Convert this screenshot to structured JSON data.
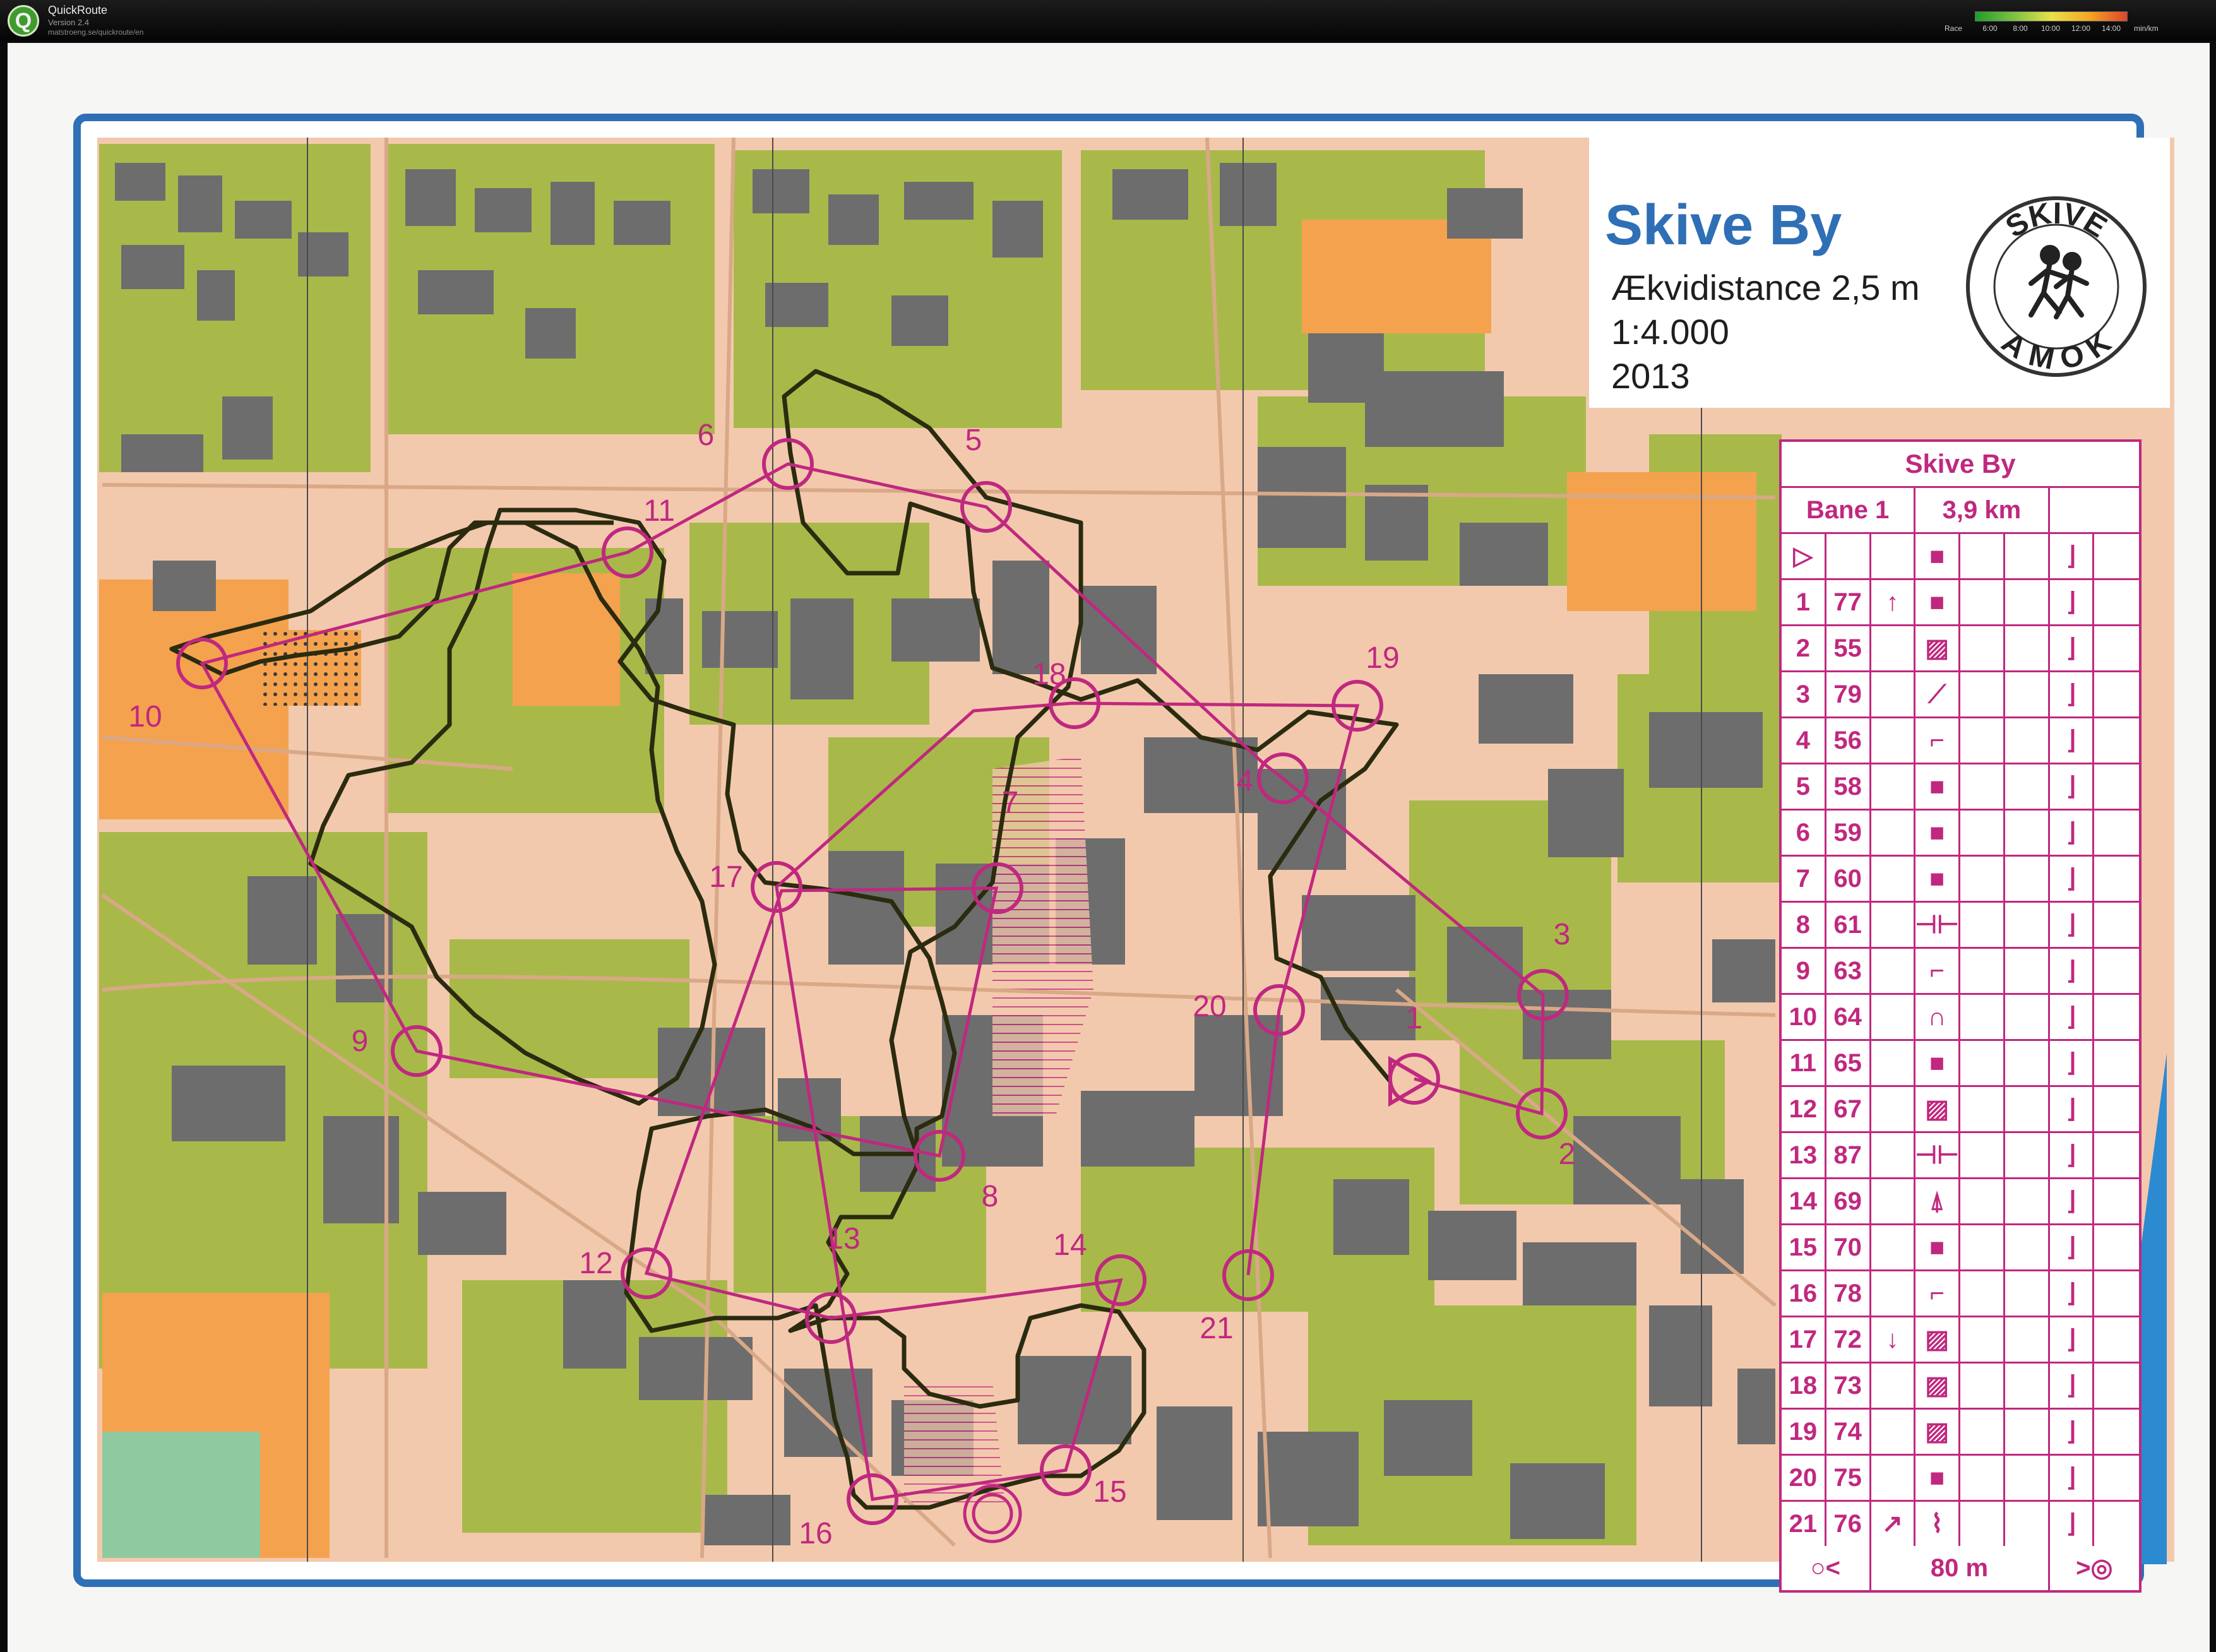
{
  "app": {
    "name": "QuickRoute",
    "version": "Version 2.4",
    "url": "matstroeng.se/quickroute/en",
    "legend_label": "Race",
    "legend_unit": "min/km",
    "legend_ticks": [
      "6:00",
      "8:00",
      "10:00",
      "12:00",
      "14:00"
    ]
  },
  "map": {
    "title": "Skive By",
    "equidistance": "Ækvidistance 2,5 m",
    "scale": "1:4.000",
    "year": "2013",
    "club_logo_top": "SKIVE",
    "club_logo_bottom": "AMOK",
    "colors": {
      "frame": "#2e6fb5",
      "paved": "#f3c9ad",
      "park": "#a8b94a",
      "building": "#6d6d6d",
      "open": "#f5a24e",
      "course": "#c0287f",
      "route": "#2b2b0f",
      "water": "#2c8ad0"
    }
  },
  "controls": [
    {
      "label": "1"
    },
    {
      "label": "2"
    },
    {
      "label": "3"
    },
    {
      "label": "4"
    },
    {
      "label": "5"
    },
    {
      "label": "6"
    },
    {
      "label": "7"
    },
    {
      "label": "8"
    },
    {
      "label": "9"
    },
    {
      "label": "10"
    },
    {
      "label": "11"
    },
    {
      "label": "12"
    },
    {
      "label": "13"
    },
    {
      "label": "14"
    },
    {
      "label": "15"
    },
    {
      "label": "16"
    },
    {
      "label": "17"
    },
    {
      "label": "18"
    },
    {
      "label": "19"
    },
    {
      "label": "20"
    },
    {
      "label": "21"
    }
  ],
  "description_sheet": {
    "title": "Skive By",
    "course": "Bane 1",
    "length": "3,9 km",
    "start_symbol": "triangle",
    "rows": [
      {
        "num": "1",
        "code": "77",
        "direction": "↑",
        "feature": "square"
      },
      {
        "num": "2",
        "code": "55",
        "direction": "",
        "feature": "hatched"
      },
      {
        "num": "3",
        "code": "79",
        "direction": "",
        "feature": "line"
      },
      {
        "num": "4",
        "code": "56",
        "direction": "",
        "feature": "steps"
      },
      {
        "num": "5",
        "code": "58",
        "direction": "",
        "feature": "square"
      },
      {
        "num": "6",
        "code": "59",
        "direction": "",
        "feature": "square"
      },
      {
        "num": "7",
        "code": "60",
        "direction": "",
        "feature": "square"
      },
      {
        "num": "8",
        "code": "61",
        "direction": "",
        "feature": "passage"
      },
      {
        "num": "9",
        "code": "63",
        "direction": "",
        "feature": "steps"
      },
      {
        "num": "10",
        "code": "64",
        "direction": "",
        "feature": "knoll"
      },
      {
        "num": "11",
        "code": "65",
        "direction": "",
        "feature": "square"
      },
      {
        "num": "12",
        "code": "67",
        "direction": "",
        "feature": "hatched"
      },
      {
        "num": "13",
        "code": "87",
        "direction": "",
        "feature": "passage"
      },
      {
        "num": "14",
        "code": "69",
        "direction": "",
        "feature": "monument"
      },
      {
        "num": "15",
        "code": "70",
        "direction": "",
        "feature": "square"
      },
      {
        "num": "16",
        "code": "78",
        "direction": "",
        "feature": "steps"
      },
      {
        "num": "17",
        "code": "72",
        "direction": "↓",
        "feature": "hatched"
      },
      {
        "num": "18",
        "code": "73",
        "direction": "",
        "feature": "hatched"
      },
      {
        "num": "19",
        "code": "74",
        "direction": "",
        "feature": "hatched"
      },
      {
        "num": "20",
        "code": "75",
        "direction": "",
        "feature": "square"
      },
      {
        "num": "21",
        "code": "76",
        "direction": "↗",
        "feature": "fence"
      }
    ],
    "finish_distance": "80 m"
  }
}
